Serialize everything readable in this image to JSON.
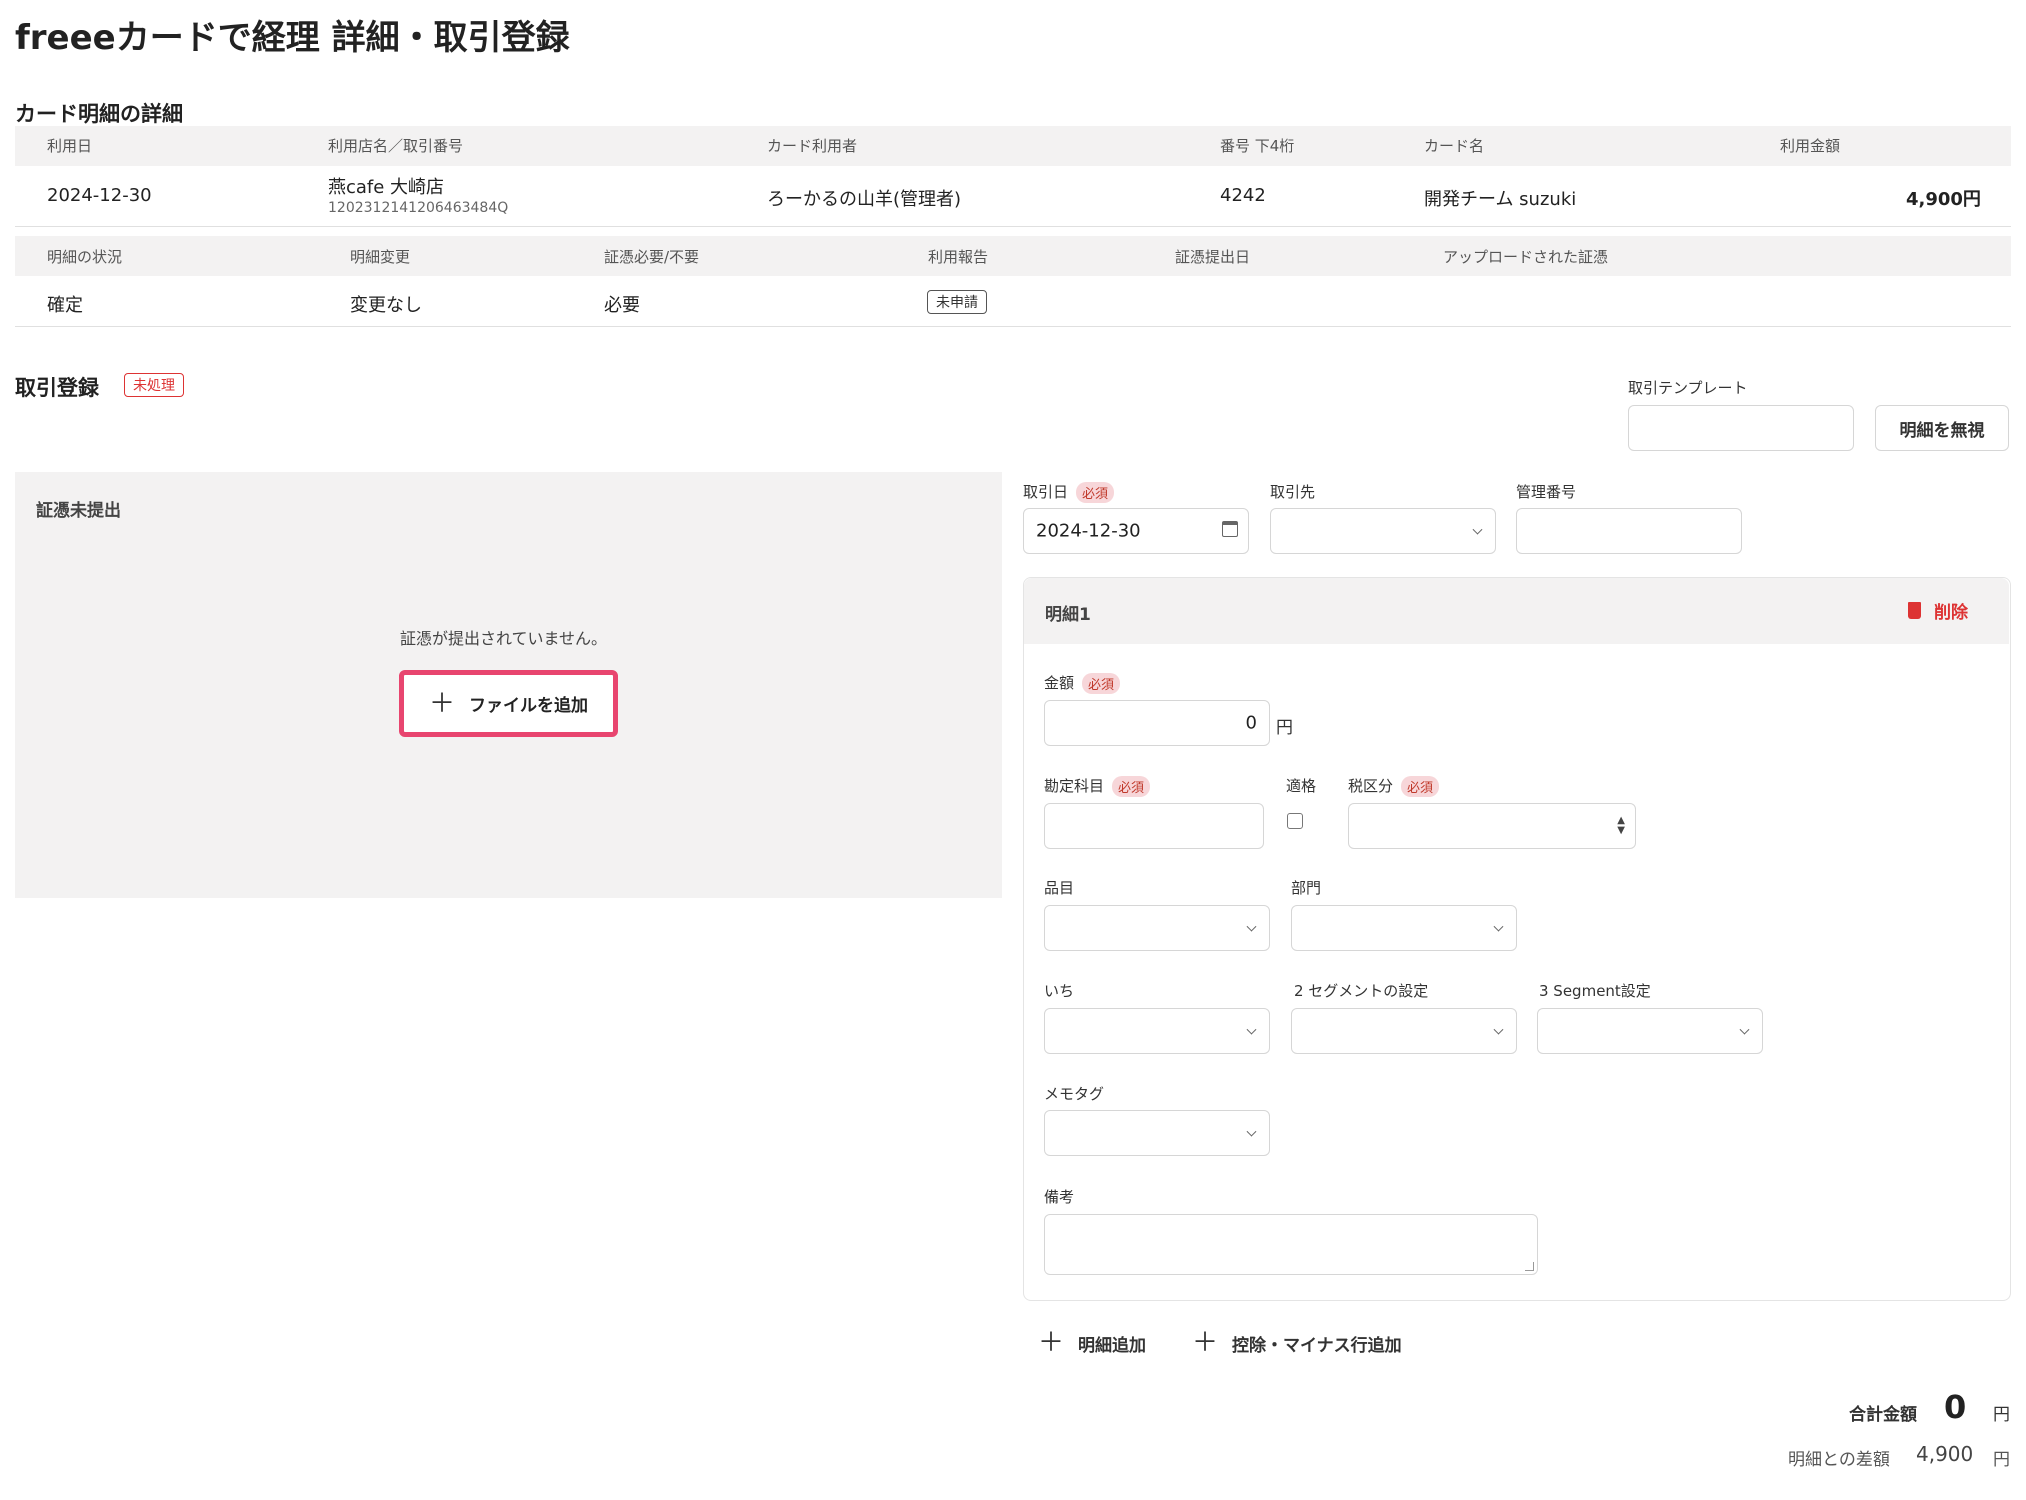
{
  "page_title": "freeeカードで経理 詳細・取引登録",
  "card_detail": {
    "section_title": "カード明細の詳細",
    "headers": {
      "date": "利用日",
      "store": "利用店名／取引番号",
      "user": "カード利用者",
      "last4_label": "番号 下4桁",
      "card_name": "カード名",
      "amount": "利用金額"
    },
    "row": {
      "date": "2024-12-30",
      "store": "燕cafe 大崎店",
      "transaction_no": "1202312141206463484Q",
      "user": "ろーかるの山羊(管理者)",
      "last4": "4242",
      "card_name": "開発チーム suzuki",
      "amount": "4,900円"
    },
    "status_headers": {
      "status": "明細の状況",
      "change": "明細変更",
      "receipt_required": "証憑必要/不要",
      "usage_report": "利用報告",
      "receipt_date": "証憑提出日",
      "uploaded": "アップロードされた証憑"
    },
    "status_row": {
      "status": "確定",
      "change": "変更なし",
      "receipt_required": "必要",
      "usage_report": "未申請"
    }
  },
  "registration": {
    "section_title": "取引登録",
    "status_badge": "未処理",
    "template_label": "取引テンプレート",
    "template_value": "",
    "ignore_button": "明細を無視"
  },
  "receipt_panel": {
    "title": "証憑未提出",
    "message": "証憑が提出されていません。",
    "add_file_button": "ファイルを追加"
  },
  "form": {
    "required": "必須",
    "date_label": "取引日",
    "date_value": "2024-12-30",
    "partner_label": "取引先",
    "mgmt_no_label": "管理番号",
    "line": {
      "title": "明細1",
      "delete": "削除",
      "amount_label": "金額",
      "amount_value": "0",
      "yen": "円",
      "account_label": "勘定科目",
      "qualified_label": "適格",
      "tax_label": "税区分",
      "item_label": "品目",
      "dept_label": "部門",
      "seg1_label": "いち",
      "seg2_label": "2 セグメントの設定",
      "seg3_label": "3 Segment設定",
      "memo_tag_label": "メモタグ",
      "note_label": "備考"
    },
    "add_line": "明細追加",
    "add_deduction": "控除・マイナス行追加"
  },
  "totals": {
    "total_label": "合計金額",
    "total_value": "0",
    "total_unit": "円",
    "diff_label": "明細との差額",
    "diff_value": "4,900",
    "diff_unit": "円"
  },
  "colors": {
    "accent_pink": "#e8456f",
    "required_bg": "#f7d6d9",
    "danger": "#d33"
  }
}
